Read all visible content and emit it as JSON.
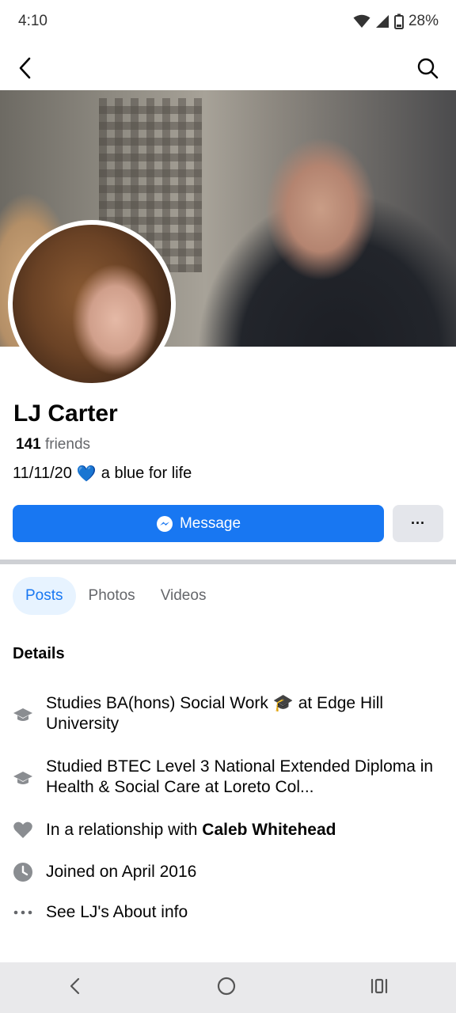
{
  "status": {
    "time": "4:10",
    "battery": "28%"
  },
  "nav": {
    "back_icon": "back-arrow-icon",
    "search_icon": "search-icon"
  },
  "profile": {
    "name": "LJ Carter",
    "friends_count": "141",
    "friends_label": "friends",
    "bio_prefix": "11/11/20",
    "bio_emoji": "💙",
    "bio_suffix": "a blue for life"
  },
  "actions": {
    "message_label": "Message",
    "more_label": "···"
  },
  "tabs": [
    {
      "label": "Posts",
      "active": true
    },
    {
      "label": "Photos",
      "active": false
    },
    {
      "label": "Videos",
      "active": false
    }
  ],
  "details": {
    "title": "Details",
    "items": [
      {
        "icon": "graduation-cap-icon",
        "text": "Studies BA(hons) Social Work 🎓 at Edge Hill University"
      },
      {
        "icon": "graduation-cap-icon",
        "text": "Studied BTEC Level 3 National Extended Diploma in Health & Social Care at Loreto Col..."
      },
      {
        "icon": "heart-icon",
        "text_prefix": "In a relationship with ",
        "text_bold": "Caleb Whitehead"
      },
      {
        "icon": "clock-icon",
        "text": "Joined on April 2016"
      },
      {
        "icon": "more-dots-icon",
        "text": "See LJ's About info"
      }
    ]
  },
  "colors": {
    "accent": "#1877f2",
    "tab_active_bg": "#e7f3ff",
    "icon_gray": "#8a8d91"
  }
}
